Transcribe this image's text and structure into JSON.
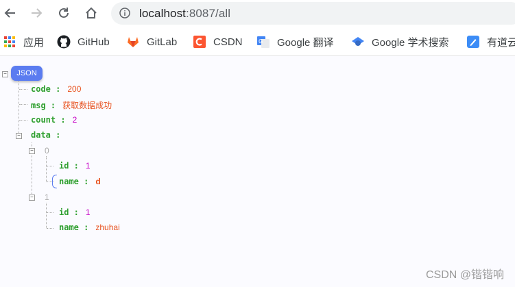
{
  "browser": {
    "url_host": "localhost",
    "url_rest": ":8087/all"
  },
  "bookmarks": [
    {
      "label": "应用",
      "icon": "apps-grid-icon"
    },
    {
      "label": "GitHub",
      "icon": "github-icon"
    },
    {
      "label": "GitLab",
      "icon": "gitlab-icon"
    },
    {
      "label": "CSDN",
      "icon": "csdn-icon"
    },
    {
      "label": "Google 翻译",
      "icon": "google-translate-icon"
    },
    {
      "label": "Google 学术搜索",
      "icon": "google-scholar-icon"
    },
    {
      "label": "有道云",
      "icon": "youdao-icon"
    }
  ],
  "json_viewer": {
    "root_label": "JSON",
    "code_key": "code :",
    "code_val": "200",
    "msg_key": "msg :",
    "msg_val": "获取数据成功",
    "count_key": "count :",
    "count_val": "2",
    "data_key": "data :",
    "item0_index": "0",
    "item0_id_key": "id :",
    "item0_id_val": "1",
    "item0_name_key": "name :",
    "item0_name_val": "d",
    "item1_index": "1",
    "item1_id_key": "id :",
    "item1_id_val": "1",
    "item1_name_key": "name :",
    "item1_name_val": "zhuhai"
  },
  "watermark": "CSDN @锴锴响",
  "colors": {
    "key": "#2e9f2e",
    "string": "#e8511e",
    "number": "#c600c6",
    "badge": "#5b7cf0"
  }
}
